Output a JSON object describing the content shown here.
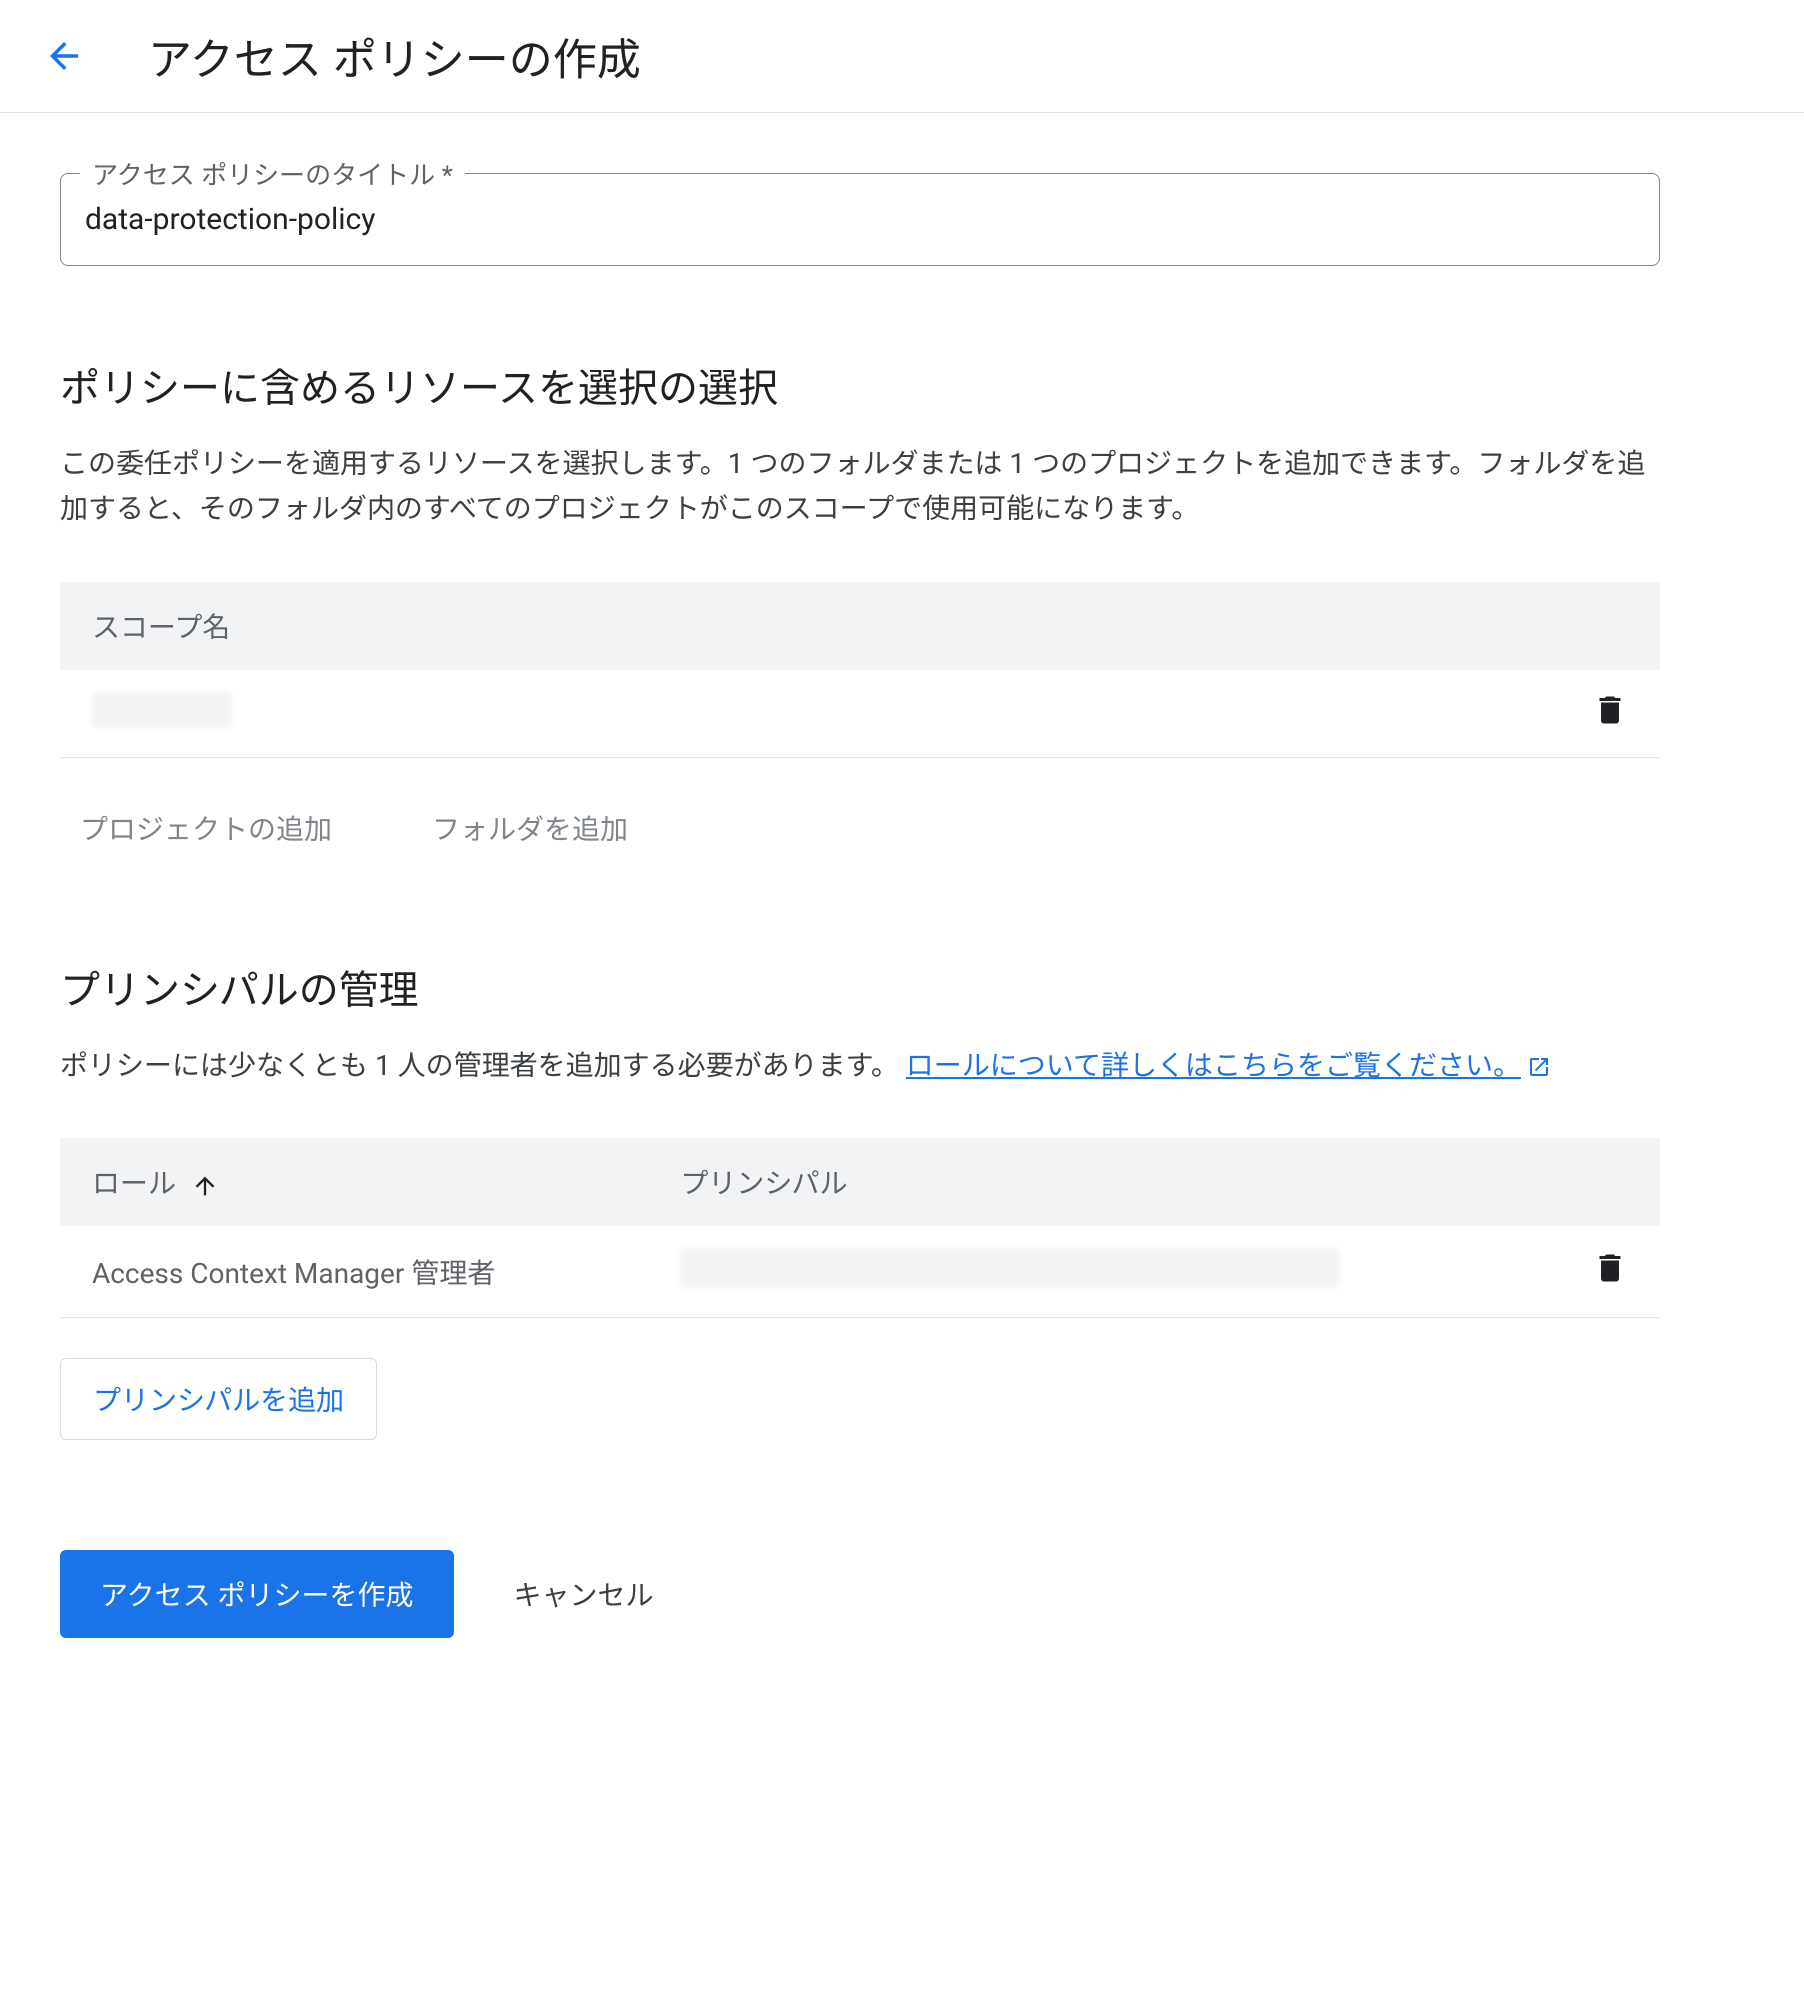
{
  "header": {
    "title": "アクセス ポリシーの作成"
  },
  "titleField": {
    "label": "アクセス ポリシーのタイトル *",
    "value": "data-protection-policy"
  },
  "resources": {
    "heading": "ポリシーに含めるリソースを選択の選択",
    "description": "この委任ポリシーを適用するリソースを選択します。1 つのフォルダまたは 1 つのプロジェクトを追加できます。フォルダを追加すると、そのフォルダ内のすべてのプロジェクトがこのスコープで使用可能になります。",
    "columnScope": "スコープ名",
    "addProject": "プロジェクトの追加",
    "addFolder": "フォルダを追加"
  },
  "principals": {
    "heading": "プリンシパルの管理",
    "descPrefix": "ポリシーには少なくとも 1 人の管理者を追加する必要があります。",
    "linkText": "ロールについて詳しくはこちらをご覧ください。",
    "columnRole": "ロール",
    "columnPrincipal": "プリンシパル",
    "row1Role": "Access Context Manager 管理者",
    "addPrincipal": "プリンシパルを追加"
  },
  "footer": {
    "create": "アクセス ポリシーを作成",
    "cancel": "キャンセル"
  }
}
